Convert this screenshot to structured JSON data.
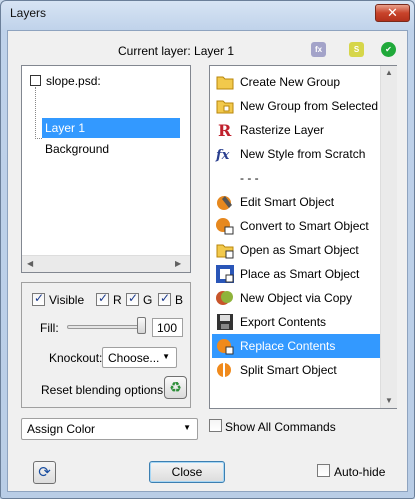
{
  "window": {
    "title": "Layers",
    "close_glyph": "✕"
  },
  "header": {
    "current_layer": "Current layer: Layer 1",
    "badges": [
      {
        "name": "fx-badge",
        "text": "fx",
        "color": "#a3a3c9"
      },
      {
        "name": "smart-badge",
        "text": "S",
        "color": "#d6d64a"
      },
      {
        "name": "ok-badge",
        "text": "✔",
        "color": "#20a93a"
      }
    ]
  },
  "tree": {
    "items": [
      {
        "label": "slope.psd:"
      },
      {
        "label": "Layer 1"
      },
      {
        "label": "Background"
      }
    ]
  },
  "blending": {
    "visible_label": "Visible",
    "r_label": "R",
    "g_label": "G",
    "b_label": "B",
    "fill_label": "Fill:",
    "fill_value": "100",
    "fill_level": 1.0,
    "knockout_label": "Knockout:",
    "knockout_value": "Choose...",
    "reset_label": "Reset blending options:"
  },
  "commands": [
    {
      "label": "Create New Group",
      "icon": "folder-icon"
    },
    {
      "label": "New Group from Selected",
      "icon": "folder-new-icon"
    },
    {
      "label": "Rasterize Layer",
      "icon": "rasterize-icon"
    },
    {
      "label": "New Style from Scratch",
      "icon": "fx-icon"
    },
    {
      "label": "- - -",
      "icon": ""
    },
    {
      "label": "Edit Smart Object",
      "icon": "edit-smart-icon"
    },
    {
      "label": "Convert to Smart Object",
      "icon": "convert-smart-icon"
    },
    {
      "label": "Open as Smart Object",
      "icon": "open-smart-icon"
    },
    {
      "label": "Place as Smart Object",
      "icon": "place-smart-icon"
    },
    {
      "label": "New Object via Copy",
      "icon": "copy-smart-icon"
    },
    {
      "label": "Export Contents",
      "icon": "export-icon"
    },
    {
      "label": "Replace Contents",
      "icon": "replace-icon"
    },
    {
      "label": "Split Smart Object",
      "icon": "split-icon"
    }
  ],
  "footer": {
    "assign_color": "Assign Color",
    "show_all_label": "Show All Commands",
    "close_label": "Close",
    "autohide_label": "Auto-hide"
  }
}
